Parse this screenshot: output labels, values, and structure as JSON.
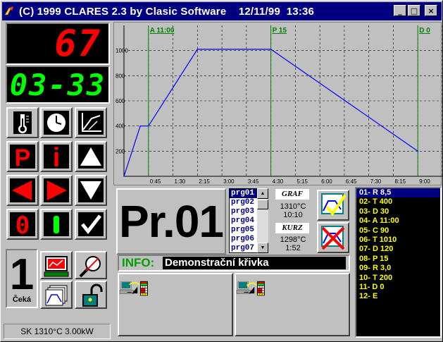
{
  "window": {
    "title": "(C) 1999 CLARES 2.3 by Clasic Software    12/11/99  13:36",
    "minimize_glyph": "_",
    "maximize_glyph": "□",
    "close_glyph": "×"
  },
  "display": {
    "temperature": "67",
    "time": "03-33"
  },
  "keypad": {
    "p_label": "P",
    "i_label": "i",
    "zero_label": "0",
    "one_label": "I"
  },
  "chart_data": {
    "type": "line",
    "x_ticks": [
      "0:45",
      "1:30",
      "2:15",
      "3:00",
      "3:45",
      "4:30",
      "5:15",
      "6:00",
      "6:45",
      "7:30",
      "8:15",
      "9:00",
      "9:45"
    ],
    "y_ticks": [
      "200",
      "400",
      "600",
      "800",
      "1000"
    ],
    "x": [
      "0:00",
      "0:30",
      "0:45",
      "2:15",
      "4:30",
      "9:00"
    ],
    "y": [
      0,
      400,
      400,
      1010,
      1010,
      200
    ],
    "markers": [
      {
        "label": "A 11:00",
        "x": "0:45"
      },
      {
        "label": "P 15",
        "x": "4:30"
      },
      {
        "label": "D 0",
        "x": "9:00"
      }
    ],
    "ylim": [
      0,
      1200
    ],
    "xlim": [
      "0:00",
      "9:45"
    ],
    "grid": true,
    "line_color": "#0000ff",
    "marker_color": "#008000"
  },
  "program": {
    "name": "Pr.01",
    "list": [
      "prg01",
      "prg02",
      "prg03",
      "prg04",
      "prg05",
      "prg06",
      "prg07"
    ],
    "selected_index": 0,
    "graf_label": "GRAF",
    "graf_temp": "1310°C",
    "graf_time": "10:10",
    "kurz_label": "KURZ",
    "kurz_temp": "1298°C",
    "kurz_time": "1:52",
    "info_label": "INFO:",
    "info_value": "Demonstrační křivka"
  },
  "steps": {
    "items": [
      "01- R 8,5",
      "02- T 400",
      "03- D 30",
      "04- A 11:00",
      "05- C 90",
      "06- T 1010",
      "07- D 120",
      "08- P 15",
      "09- R 3,0",
      "10- T 200",
      "11- D 0",
      "12- E"
    ],
    "selected_index": 0
  },
  "station": {
    "number": "1",
    "state": "Čeká"
  },
  "status_bar": {
    "text": "SK 1310°C 3.00kW"
  },
  "colors": {
    "title_bg": "#000080",
    "led_red": "#ff0000",
    "led_green": "#00ff00",
    "step_text": "#ffff00"
  }
}
